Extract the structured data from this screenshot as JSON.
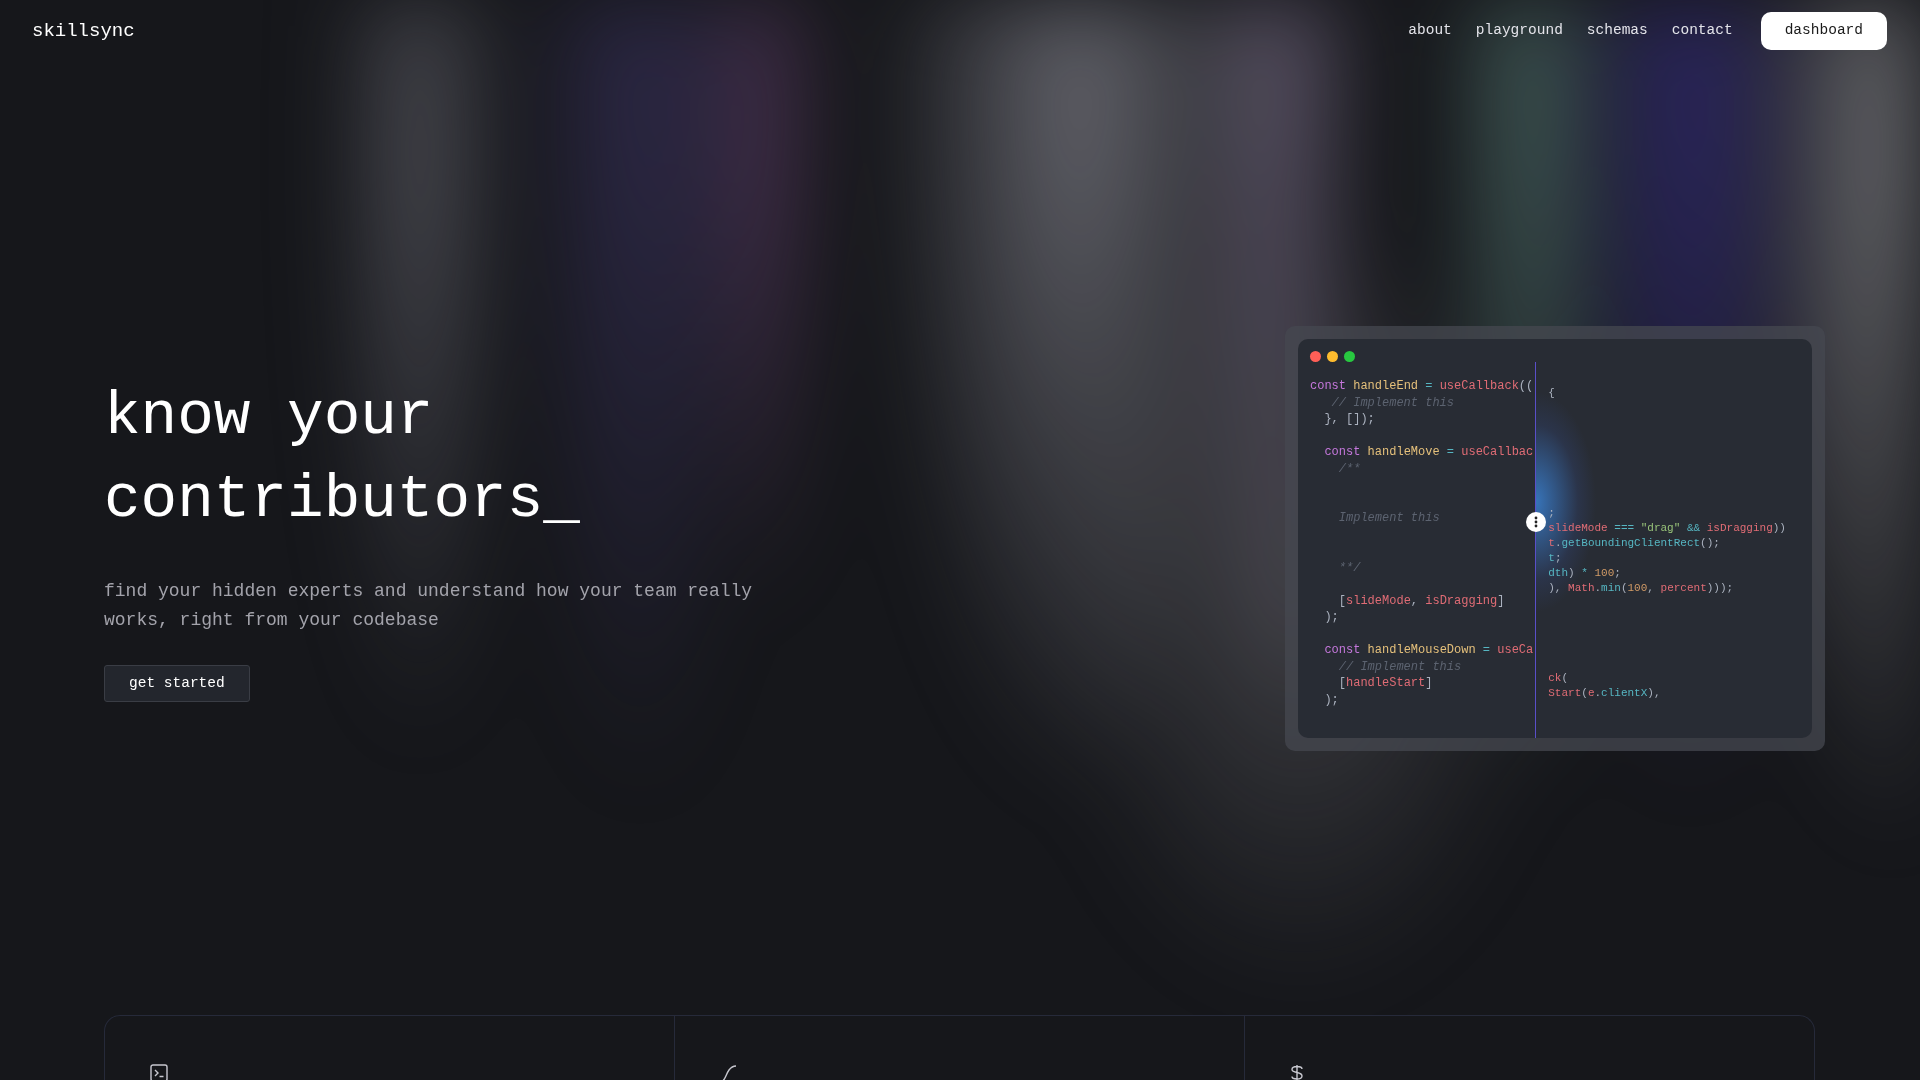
{
  "navbar": {
    "logo": "skillsync",
    "links": [
      "about",
      "playground",
      "schemas",
      "contact"
    ],
    "cta": "dashboard"
  },
  "hero": {
    "title_lines": [
      "know your",
      "contributors_"
    ],
    "subtitle": "find your hidden experts and understand how your team really works, right from your codebase",
    "button": "get started"
  },
  "code_window": {
    "left_lines": [
      {
        "kind": "code",
        "tokens": [
          {
            "kind": "kw",
            "s": "const"
          },
          {
            "kind": "fn",
            "s": " handleEnd"
          },
          {
            "kind": "op",
            "s": " ="
          },
          {
            "kind": "call",
            "s": " useCallback"
          },
          {
            "kind": "p",
            "s": "(("
          }
        ]
      },
      {
        "kind": "code",
        "tokens": [
          {
            "kind": "cm",
            "s": "   // Implement this"
          }
        ]
      },
      {
        "kind": "code",
        "tokens": [
          {
            "kind": "p",
            "s": "  }, []);"
          }
        ]
      },
      {
        "kind": "blank"
      },
      {
        "kind": "code",
        "tokens": [
          {
            "kind": "kw",
            "s": "  const"
          },
          {
            "kind": "fn",
            "s": " handleMove"
          },
          {
            "kind": "op",
            "s": " ="
          },
          {
            "kind": "call",
            "s": " useCallbac"
          }
        ]
      },
      {
        "kind": "code",
        "tokens": [
          {
            "kind": "cm",
            "s": "    /**"
          }
        ]
      },
      {
        "kind": "blank"
      },
      {
        "kind": "blank"
      },
      {
        "kind": "code",
        "tokens": [
          {
            "kind": "cm",
            "s": "    Implement this"
          }
        ]
      },
      {
        "kind": "blank"
      },
      {
        "kind": "blank"
      },
      {
        "kind": "code",
        "tokens": [
          {
            "kind": "cm",
            "s": "    **/"
          }
        ]
      },
      {
        "kind": "blank"
      },
      {
        "kind": "code",
        "tokens": [
          {
            "kind": "p",
            "s": "    ["
          },
          {
            "kind": "call",
            "s": "slideMode"
          },
          {
            "kind": "p",
            "s": ", "
          },
          {
            "kind": "call",
            "s": "isDragging"
          },
          {
            "kind": "p",
            "s": "]"
          }
        ]
      },
      {
        "kind": "code",
        "tokens": [
          {
            "kind": "p",
            "s": "  );"
          }
        ]
      },
      {
        "kind": "blank"
      },
      {
        "kind": "code",
        "tokens": [
          {
            "kind": "kw",
            "s": "  const"
          },
          {
            "kind": "fn",
            "s": " handleMouseDown"
          },
          {
            "kind": "op",
            "s": " ="
          },
          {
            "kind": "call",
            "s": " useCa"
          }
        ]
      },
      {
        "kind": "code",
        "tokens": [
          {
            "kind": "cm",
            "s": "    // Implement this"
          }
        ]
      },
      {
        "kind": "code",
        "tokens": [
          {
            "kind": "p",
            "s": "    ["
          },
          {
            "kind": "call",
            "s": "handleStart"
          },
          {
            "kind": "p",
            "s": "]"
          }
        ]
      },
      {
        "kind": "code",
        "tokens": [
          {
            "kind": "p",
            "s": "  );"
          }
        ]
      }
    ],
    "right_lines": [
      {
        "kind": "code",
        "tokens": [
          {
            "kind": "p",
            "s": "{"
          }
        ]
      },
      {
        "kind": "blank"
      },
      {
        "kind": "blank"
      },
      {
        "kind": "blank"
      },
      {
        "kind": "blank"
      },
      {
        "kind": "blank"
      },
      {
        "kind": "blank"
      },
      {
        "kind": "blank"
      },
      {
        "kind": "code",
        "tokens": [
          {
            "kind": "p",
            "s": ";"
          }
        ]
      },
      {
        "kind": "code",
        "tokens": [
          {
            "kind": "call",
            "s": "slideMode"
          },
          {
            "kind": "op",
            "s": " ==="
          },
          {
            "kind": "str",
            "s": " \"drag\""
          },
          {
            "kind": "op",
            "s": " &&"
          },
          {
            "kind": "call",
            "s": " isDragging"
          },
          {
            "kind": "p",
            "s": "))"
          }
        ]
      },
      {
        "kind": "code",
        "tokens": [
          {
            "kind": "call",
            "s": "t"
          },
          {
            "kind": "p",
            "s": "."
          },
          {
            "kind": "op",
            "s": "getBoundingClientRect"
          },
          {
            "kind": "p",
            "s": "();"
          }
        ]
      },
      {
        "kind": "code",
        "tokens": [
          {
            "kind": "op",
            "s": "t"
          },
          {
            "kind": "p",
            "s": ";"
          }
        ]
      },
      {
        "kind": "code",
        "tokens": [
          {
            "kind": "op",
            "s": "dth"
          },
          {
            "kind": "p",
            "s": ")"
          },
          {
            "kind": "op",
            "s": " *"
          },
          {
            "kind": "num",
            "s": " 100"
          },
          {
            "kind": "p",
            "s": ";"
          }
        ]
      },
      {
        "kind": "code",
        "tokens": [
          {
            "kind": "p",
            "s": "), "
          },
          {
            "kind": "call",
            "s": "Math"
          },
          {
            "kind": "p",
            "s": "."
          },
          {
            "kind": "op",
            "s": "min"
          },
          {
            "kind": "p",
            "s": "("
          },
          {
            "kind": "num",
            "s": "100"
          },
          {
            "kind": "p",
            "s": ", "
          },
          {
            "kind": "call",
            "s": "percent"
          },
          {
            "kind": "p",
            "s": ")));"
          }
        ]
      },
      {
        "kind": "blank"
      },
      {
        "kind": "blank"
      },
      {
        "kind": "blank"
      },
      {
        "kind": "blank"
      },
      {
        "kind": "blank"
      },
      {
        "kind": "code",
        "tokens": [
          {
            "kind": "call",
            "s": "ck"
          },
          {
            "kind": "p",
            "s": "("
          }
        ]
      },
      {
        "kind": "code",
        "tokens": [
          {
            "kind": "call",
            "s": "Start"
          },
          {
            "kind": "p",
            "s": "("
          },
          {
            "kind": "call",
            "s": "e"
          },
          {
            "kind": "p",
            "s": "."
          },
          {
            "kind": "op",
            "s": "clientX"
          },
          {
            "kind": "p",
            "s": "),"
          }
        ]
      }
    ]
  },
  "features": [
    {
      "kind": "terminal"
    },
    {
      "kind": "curve"
    },
    {
      "kind": "dollar"
    }
  ]
}
